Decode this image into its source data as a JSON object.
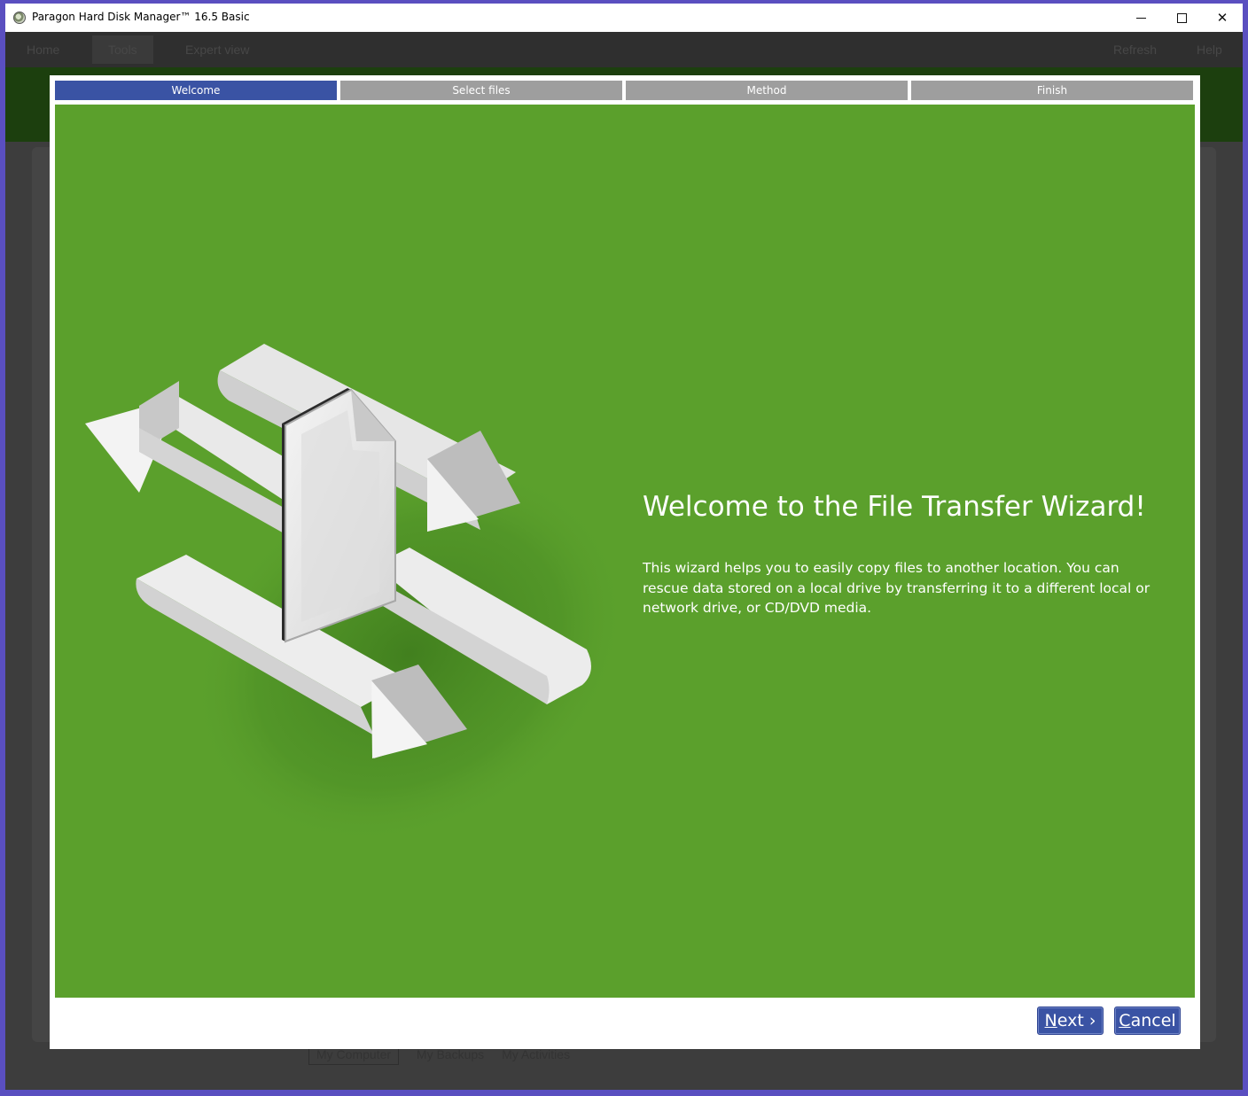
{
  "window": {
    "title": "Paragon Hard Disk Manager™ 16.5 Basic"
  },
  "background_app": {
    "tabs": [
      "Home",
      "Tools",
      "Expert view"
    ],
    "right_actions": [
      "Refresh",
      "Help"
    ],
    "bottom_tabs": [
      "My Computer",
      "My Backups",
      "My Activities"
    ]
  },
  "wizard": {
    "steps": [
      "Welcome",
      "Select files",
      "Method",
      "Finish"
    ],
    "active_step": "Welcome",
    "title": "Welcome to the File Transfer Wizard!",
    "description": "This wizard helps you to easily copy files to another location. You can rescue data stored on a local drive by transferring it to a different local or network drive, or CD/DVD media.",
    "buttons": {
      "next_mnemonic": "N",
      "next_rest": "ext ›",
      "cancel_mnemonic": "C",
      "cancel_rest": "ancel"
    }
  },
  "colors": {
    "hero_green": "#5ba02c",
    "accent_blue": "#3a53a4",
    "step_inactive": "#9e9e9e"
  }
}
